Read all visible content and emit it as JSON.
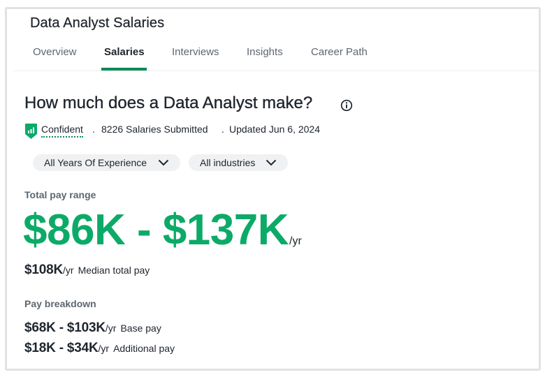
{
  "page": {
    "title": "Data Analyst Salaries"
  },
  "tabs": [
    {
      "label": "Overview",
      "active": false
    },
    {
      "label": "Salaries",
      "active": true
    },
    {
      "label": "Interviews",
      "active": false
    },
    {
      "label": "Insights",
      "active": false
    },
    {
      "label": "Career Path",
      "active": false
    }
  ],
  "summary": {
    "heading": "How much does a Data Analyst make?",
    "confidence_label": "Confident",
    "separator": ".",
    "salaries_submitted": "8226 Salaries Submitted",
    "updated": "Updated Jun 6, 2024"
  },
  "filters": {
    "experience": "All Years Of Experience",
    "industry": "All industries"
  },
  "total_pay": {
    "label": "Total pay range",
    "range": "$86K - $137K",
    "unit": "/yr"
  },
  "median": {
    "value": "$108K",
    "unit": "/yr",
    "label": "Median total pay"
  },
  "breakdown": {
    "label": "Pay breakdown",
    "items": [
      {
        "range": "$68K - $103K",
        "unit": "/yr",
        "label": "Base pay"
      },
      {
        "range": "$18K - $34K",
        "unit": "/yr",
        "label": "Additional pay"
      }
    ]
  },
  "colors": {
    "accent_green": "#0caa68",
    "tab_underline": "#0c8a56",
    "text_primary": "#20262e",
    "text_secondary": "#5d6670",
    "pill_bg": "#f0f1f3"
  }
}
